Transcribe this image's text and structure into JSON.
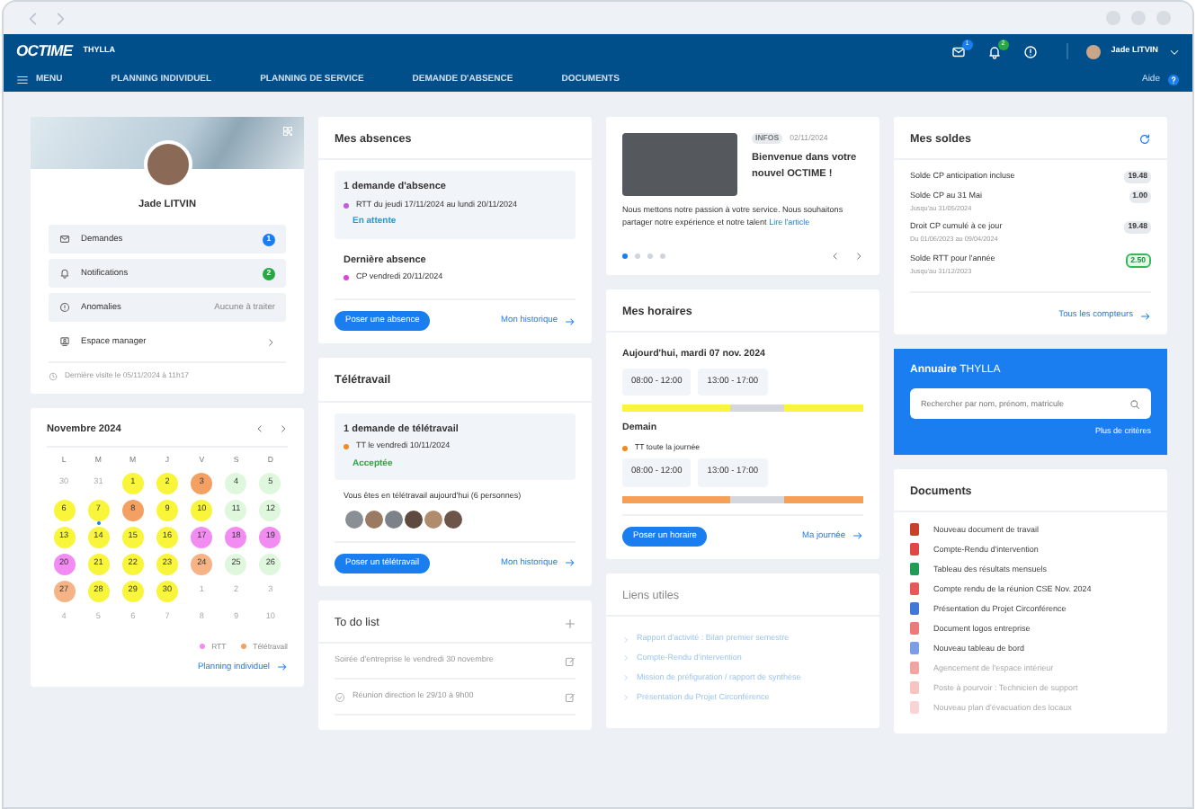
{
  "header": {
    "logo": "OCTIME",
    "company": "THYLLA",
    "mail_count": "1",
    "bell_count": "2",
    "user": "Jade LITVIN",
    "menu": "MENU",
    "nav": [
      {
        "label": "PLANNING INDIVIDUEL",
        "selected": false
      },
      {
        "label": "PLANNING DE SERVICE",
        "selected": false
      },
      {
        "label": "DEMANDE D'ABSENCE",
        "selected": false
      },
      {
        "label": "DOCUMENTS",
        "selected": false
      }
    ],
    "help": "Aide"
  },
  "profile": {
    "name": "Jade LITVIN",
    "items": [
      {
        "kind": "badge",
        "label": "Demandes",
        "value": "1",
        "color": "#1a7ef0"
      },
      {
        "kind": "badge",
        "label": "Notifications",
        "value": "2",
        "color": "#27a844"
      },
      {
        "kind": "text",
        "label": "Anomalies",
        "value": "Aucune à traiter"
      },
      {
        "kind": "link",
        "label": "Espace manager"
      }
    ],
    "last_visit": "Dernière visite le 05/11/2024 à 11h17"
  },
  "calendar": {
    "title": "Novembre 2024",
    "weekdays": [
      "L",
      "M",
      "M",
      "J",
      "V",
      "S",
      "D"
    ],
    "weeks": [
      [
        {
          "day": "30",
          "today": false
        },
        {
          "day": "31",
          "today": false
        },
        {
          "day": "1",
          "color": "#f8f53a",
          "today": false
        },
        {
          "day": "2",
          "color": "#f8f53a",
          "today": false
        },
        {
          "day": "3",
          "color": "#f4a062",
          "today": false
        },
        {
          "day": "4",
          "color": "#dff7dc",
          "today": false
        },
        {
          "day": "5",
          "color": "#dff7dc",
          "today": false
        }
      ],
      [
        {
          "day": "6",
          "color": "#f8f53a",
          "today": false
        },
        {
          "day": "7",
          "color": "#f8f53a",
          "today": true
        },
        {
          "day": "8",
          "color": "#f4a062",
          "today": false
        },
        {
          "day": "9",
          "color": "#f8f53a",
          "today": false
        },
        {
          "day": "10",
          "color": "#f8f53a",
          "today": false
        },
        {
          "day": "11",
          "color": "#dff7dc",
          "today": false
        },
        {
          "day": "12",
          "color": "#dff7dc",
          "today": false
        }
      ],
      [
        {
          "day": "13",
          "color": "#f8f53a",
          "today": false
        },
        {
          "day": "14",
          "color": "#f8f53a",
          "today": false
        },
        {
          "day": "15",
          "color": "#f8f53a",
          "today": false
        },
        {
          "day": "16",
          "color": "#f8f53a",
          "today": false
        },
        {
          "day": "17",
          "color": "#f28cf2",
          "today": false
        },
        {
          "day": "18",
          "color": "#f28cf2",
          "today": false
        },
        {
          "day": "19",
          "color": "#f28cf2",
          "today": false
        }
      ],
      [
        {
          "day": "20",
          "color": "#f28cf2",
          "today": false
        },
        {
          "day": "21",
          "color": "#f8f53a",
          "today": false
        },
        {
          "day": "22",
          "color": "#f8f53a",
          "today": false
        },
        {
          "day": "23",
          "color": "#f8f53a",
          "today": false
        },
        {
          "day": "24",
          "color": "#f6b486",
          "today": false
        },
        {
          "day": "25",
          "color": "#dff7dc",
          "today": false
        },
        {
          "day": "26",
          "color": "#dff7dc",
          "today": false
        }
      ],
      [
        {
          "day": "27",
          "color": "#f6b486",
          "today": false
        },
        {
          "day": "28",
          "color": "#f8f53a",
          "today": false
        },
        {
          "day": "29",
          "color": "#f8f53a",
          "today": false
        },
        {
          "day": "30",
          "color": "#f8f53a",
          "today": false
        },
        {
          "day": "1",
          "today": false
        },
        {
          "day": "2",
          "today": false
        },
        {
          "day": "3",
          "today": false
        }
      ],
      [
        {
          "day": "4",
          "today": false
        },
        {
          "day": "5",
          "today": false
        },
        {
          "day": "6",
          "today": false
        },
        {
          "day": "7",
          "today": false
        },
        {
          "day": "8",
          "today": false
        },
        {
          "day": "9",
          "today": false
        },
        {
          "day": "10",
          "today": false
        }
      ]
    ],
    "legend": [
      {
        "label": "RTT",
        "color": "#f28cf2"
      },
      {
        "label": "Télétravail",
        "color": "#f4a062"
      }
    ],
    "link": "Planning individuel"
  },
  "absences": {
    "title": "Mes absences",
    "request_title": "1 demande d'absence",
    "request": {
      "text": "RTT du jeudi 17/11/2024 au lundi 20/11/2024",
      "color": "#c05ae0",
      "status": {
        "text": "En attente",
        "color": "#1a9be0"
      }
    },
    "last_title": "Dernière absence",
    "last": {
      "text": "CP vendredi 20/11/2024",
      "color": "#e040e0"
    },
    "button": "Poser une absence",
    "link": "Mon historique"
  },
  "telework": {
    "title": "Télétravail",
    "request_title": "1 demande de télétravail",
    "request": {
      "text": "TT le vendredi 10/11/2024",
      "color": "#f28a1e",
      "status": {
        "text": "Acceptée",
        "color": "#28a745"
      }
    },
    "today_text": "Vous êtes en télétravail aujourd'hui (6 personnes)",
    "avatars": [
      {
        "kind": "person"
      },
      {
        "kind": "person"
      },
      {
        "kind": "person"
      },
      {
        "kind": "person"
      },
      {
        "kind": "person"
      },
      {
        "kind": "person"
      }
    ],
    "button": "Poser un télétravail",
    "link": "Mon historique"
  },
  "todo": {
    "title": "To do list",
    "items": [
      {
        "text": "Soirée d'entreprise le vendredi 30 novembre",
        "done": false
      },
      {
        "text": "Réunion direction le 29/10 à 9h00",
        "done": true
      }
    ]
  },
  "news": {
    "tag": "INFOS",
    "date": "02/11/2024",
    "title": "Bienvenue dans votre nouvel OCTIME !",
    "text": "Nous mettons notre passion à votre service. Nous souhaitons partager notre expérience et notre talent",
    "link": "Lire l'article",
    "dots": [
      {
        "selected": true
      },
      {
        "selected": false
      },
      {
        "selected": false
      },
      {
        "selected": false
      }
    ]
  },
  "schedule": {
    "title": "Mes horaires",
    "days": [
      {
        "title": "Aujourd'hui, mardi 07 nov. 2024",
        "slots": [
          "08:00 - 12:00",
          "13:00 - 17:00"
        ],
        "bar": [
          {
            "color": "#f8f53a"
          },
          {
            "color": "#d4d8de"
          },
          {
            "color": "#f8f53a"
          }
        ]
      },
      {
        "title": "Demain",
        "note": {
          "text": "TT toute la journée",
          "color": "#f28a1e"
        },
        "slots": [
          "08:00 - 12:00",
          "13:00 - 17:00"
        ],
        "bar": [
          {
            "color": "#f6a057"
          },
          {
            "color": "#d4d8de"
          },
          {
            "color": "#f6a057"
          }
        ]
      }
    ],
    "button": "Poser un horaire",
    "link": "Ma journée"
  },
  "links": {
    "title": "Liens utiles",
    "items": [
      "Rapport d'activité : Bilan premier semestre",
      "Compte-Rendu d'intervention",
      "Mission de préfiguration / rapport de synthèse",
      "Présentation du Projet Circonférence"
    ]
  },
  "balances": {
    "title": "Mes soldes",
    "rows": [
      {
        "label": "Solde CP anticipation incluse",
        "value": "19.48",
        "highlight": false
      },
      {
        "label": "Solde CP au 31 Mai",
        "sub": "Jusqu'au 31/05/2024",
        "value": "1.00",
        "highlight": false
      },
      {
        "label": "Droit CP cumulé à ce jour",
        "sub": "Du 01/06/2023 au 09/04/2024",
        "value": "19.48",
        "highlight": false
      },
      {
        "label": "Solde RTT pour l'année",
        "sub": "Jusqu'au 31/12/2023",
        "value": "2.50",
        "highlight": true
      }
    ],
    "link": "Tous les compteurs"
  },
  "directory": {
    "title": "**Annuaire** THYLLA",
    "placeholder": "Rechercher par nom, prénom, matricule",
    "link": "Plus de critères"
  },
  "documents": {
    "title": "Documents",
    "items": [
      {
        "name": "Nouveau document de travail",
        "color": "#c8412a"
      },
      {
        "name": "Compte-Rendu d'intervention",
        "color": "#e04848"
      },
      {
        "name": "Tableau des résultats mensuels",
        "color": "#1f9d55"
      },
      {
        "name": "Compte rendu de la réunion CSE Nov. 2024",
        "color": "#e45a5a"
      },
      {
        "name": "Présentation du Projet Circonférence",
        "color": "#3f78d8"
      },
      {
        "name": "Document logos entreprise",
        "color": "#ee7b7b"
      },
      {
        "name": "Nouveau tableau de bord",
        "color": "#7b9ee6"
      },
      {
        "name": "Agencement de l'espace intérieur",
        "color": "#f0a5a0"
      },
      {
        "name": "Poste à pourvoir : Technicien de support",
        "color": "#f7c3c3"
      },
      {
        "name": "Nouveau plan d'évacuation des locaux",
        "color": "#f9d4d4"
      }
    ]
  }
}
